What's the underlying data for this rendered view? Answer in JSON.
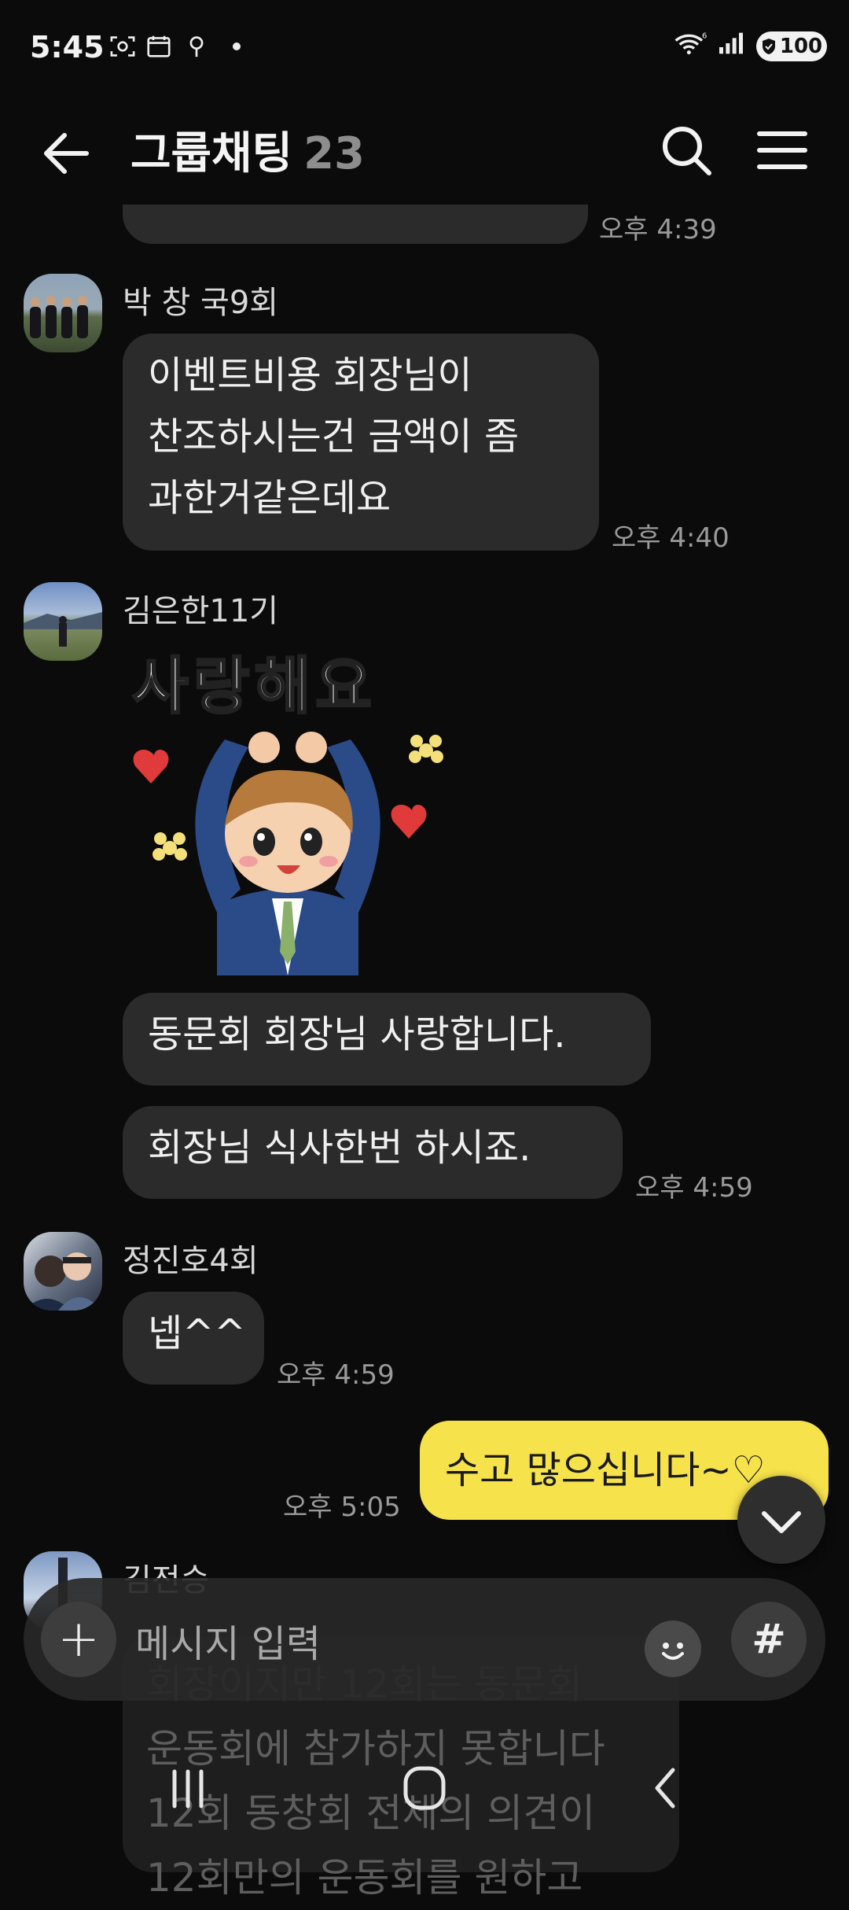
{
  "status_bar": {
    "time": "5:45",
    "battery": "100",
    "icons": [
      "screenshot-icon",
      "calendar-icon",
      "location-icon",
      "dot-icon",
      "wifi-icon",
      "signal-icon",
      "battery-icon"
    ]
  },
  "header": {
    "title": "그룹채팅",
    "member_count": "23",
    "icons": [
      "back-arrow-icon",
      "search-icon",
      "menu-icon"
    ]
  },
  "messages": [
    {
      "type": "partial",
      "time": "오후 4:39"
    },
    {
      "sender": "박 창 국9회",
      "lines": [
        "이벤트비용 회장님이",
        "찬조하시는건 금액이 좀",
        "과한거같은데요"
      ],
      "time": "오후 4:40"
    },
    {
      "sender": "김은한11기",
      "sticker_text": "사랑해요",
      "bubbles": [
        "동문회 회장님  사랑합니다.",
        "회장님  식사한번  하시죠."
      ],
      "time": "오후 4:59"
    },
    {
      "sender": "정진호4회",
      "text": "넵^^",
      "time": "오후 4:59"
    },
    {
      "mine": true,
      "text": "수고 많으십니다~♡",
      "time": "오후 5:05"
    },
    {
      "sender": "김전승",
      "lines": [
        "회장이지만  12회는 동문회",
        "운동회에 참가하지 못합니다",
        "12회 동창회 전체의 의견이",
        "12회만의 운동회를 원하고"
      ]
    }
  ],
  "input": {
    "placeholder": "메시지 입력",
    "icons": [
      "plus-icon",
      "emoji-icon",
      "hash-icon",
      "chevron-down-icon"
    ]
  },
  "colors": {
    "background": "#0b0b0b",
    "bubble": "#2b2b2b",
    "my_bubble": "#f6e24b",
    "timestamp": "#9a9a9a"
  }
}
